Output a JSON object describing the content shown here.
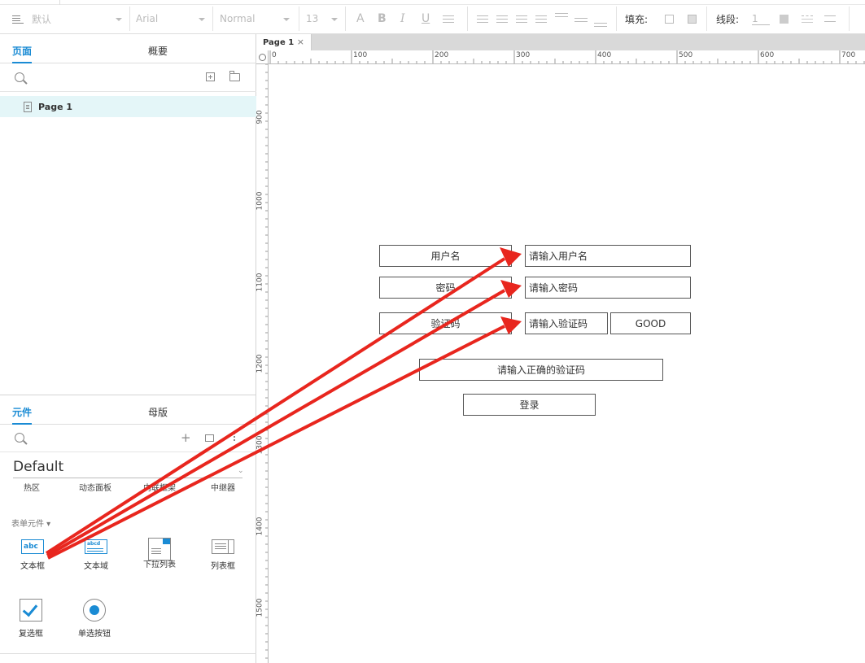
{
  "toolbar": {
    "style_select": "默认",
    "font_select": "Arial",
    "weight_select": "Normal",
    "size_select": "13",
    "fill_label": "填充:",
    "line_label": "线段:",
    "line_value": "1"
  },
  "pages_panel": {
    "tabs": [
      "页面",
      "概要"
    ],
    "active_tab": "页面",
    "pages": [
      {
        "label": "Page 1"
      }
    ]
  },
  "widgets_panel": {
    "tabs": [
      "元件",
      "母版"
    ],
    "active_tab": "元件",
    "library": "Default",
    "categories": [
      "热区",
      "动态面板",
      "内联框架",
      "中继器"
    ],
    "section": "表单元件 ▾",
    "items": [
      {
        "label": "文本框",
        "icon": "textbox-icon"
      },
      {
        "label": "文本域",
        "icon": "textarea-icon"
      },
      {
        "label": "下拉列表",
        "icon": "dropdown-icon"
      },
      {
        "label": "列表框",
        "icon": "listbox-icon"
      },
      {
        "label": "复选框",
        "icon": "checkbox-icon"
      },
      {
        "label": "单选按钮",
        "icon": "radio-icon"
      }
    ]
  },
  "document": {
    "tab": "Page 1",
    "ruler_h": [
      "0",
      "100",
      "200",
      "300",
      "400",
      "500",
      "600",
      "700"
    ],
    "ruler_v": [
      "900",
      "1000",
      "1100",
      "1200",
      "1300",
      "1400",
      "1500"
    ]
  },
  "form": {
    "username_label": "用户名",
    "username_input": "请输入用户名",
    "password_label": "密码",
    "password_input": "请输入密码",
    "captcha_label": "验证码",
    "captcha_input": "请输入验证码",
    "captcha_code": "GOOD",
    "message": "请输入正确的验证码",
    "login_button": "登录"
  },
  "colors": {
    "accent": "#1a8bd4",
    "selected_page_bg": "#e4f6f8",
    "arrow": "#e8261e"
  }
}
